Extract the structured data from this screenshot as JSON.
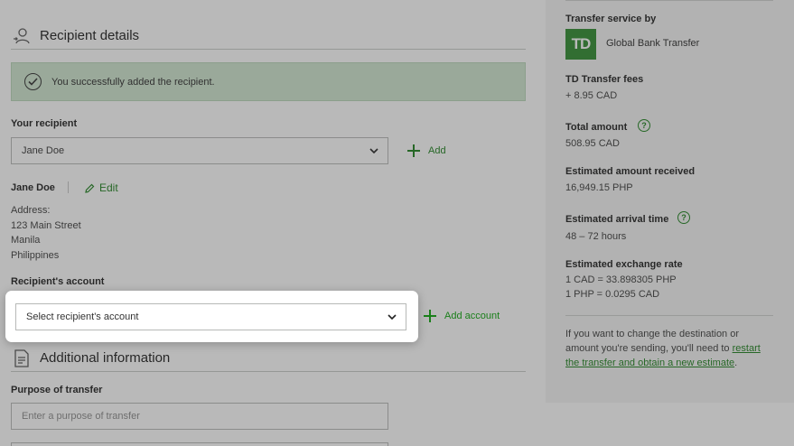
{
  "recipient_details": {
    "title": "Recipient details",
    "success_message": "You successfully added the recipient.",
    "your_recipient_label": "Your recipient",
    "recipient_select_value": "Jane Doe",
    "add_label": "Add",
    "recipient_name": "Jane Doe",
    "edit_label": "Edit",
    "address_lines": [
      "Address:",
      "123 Main Street",
      "Manila",
      "Philippines"
    ],
    "account_label": "Recipient's account",
    "account_select_placeholder": "Select recipient's account",
    "add_account_label": "Add account"
  },
  "additional_information": {
    "title": "Additional information",
    "purpose_label": "Purpose of transfer",
    "purpose_placeholder": "Enter a purpose of transfer"
  },
  "summary": {
    "service_label": "Transfer service by",
    "logo_text": "TD",
    "service_name": "Global Bank Transfer",
    "fees_label": "TD Transfer fees",
    "fees_value": "+ 8.95 CAD",
    "total_label": "Total amount",
    "total_value": "508.95 CAD",
    "received_label": "Estimated amount received",
    "received_value": "16,949.15 PHP",
    "arrival_label": "Estimated arrival time",
    "arrival_value": "48 – 72 hours",
    "rate_label": "Estimated exchange rate",
    "rate_line1": "1 CAD = 33.898305 PHP",
    "rate_line2": "1 PHP = 0.0295 CAD",
    "note_prefix": "If you want to change the destination or amount you're sending, you'll need to ",
    "note_link": "restart the transfer and obtain a new estimate",
    "note_suffix": "."
  },
  "colors": {
    "accent": "#1a7f1a",
    "success_bg": "#cfe6cf",
    "td_green": "#2c8a2c"
  },
  "icons": [
    "recipient-icon",
    "check-circle-icon",
    "chevron-down-icon",
    "plus-icon",
    "pencil-icon",
    "document-icon",
    "help-icon"
  ]
}
